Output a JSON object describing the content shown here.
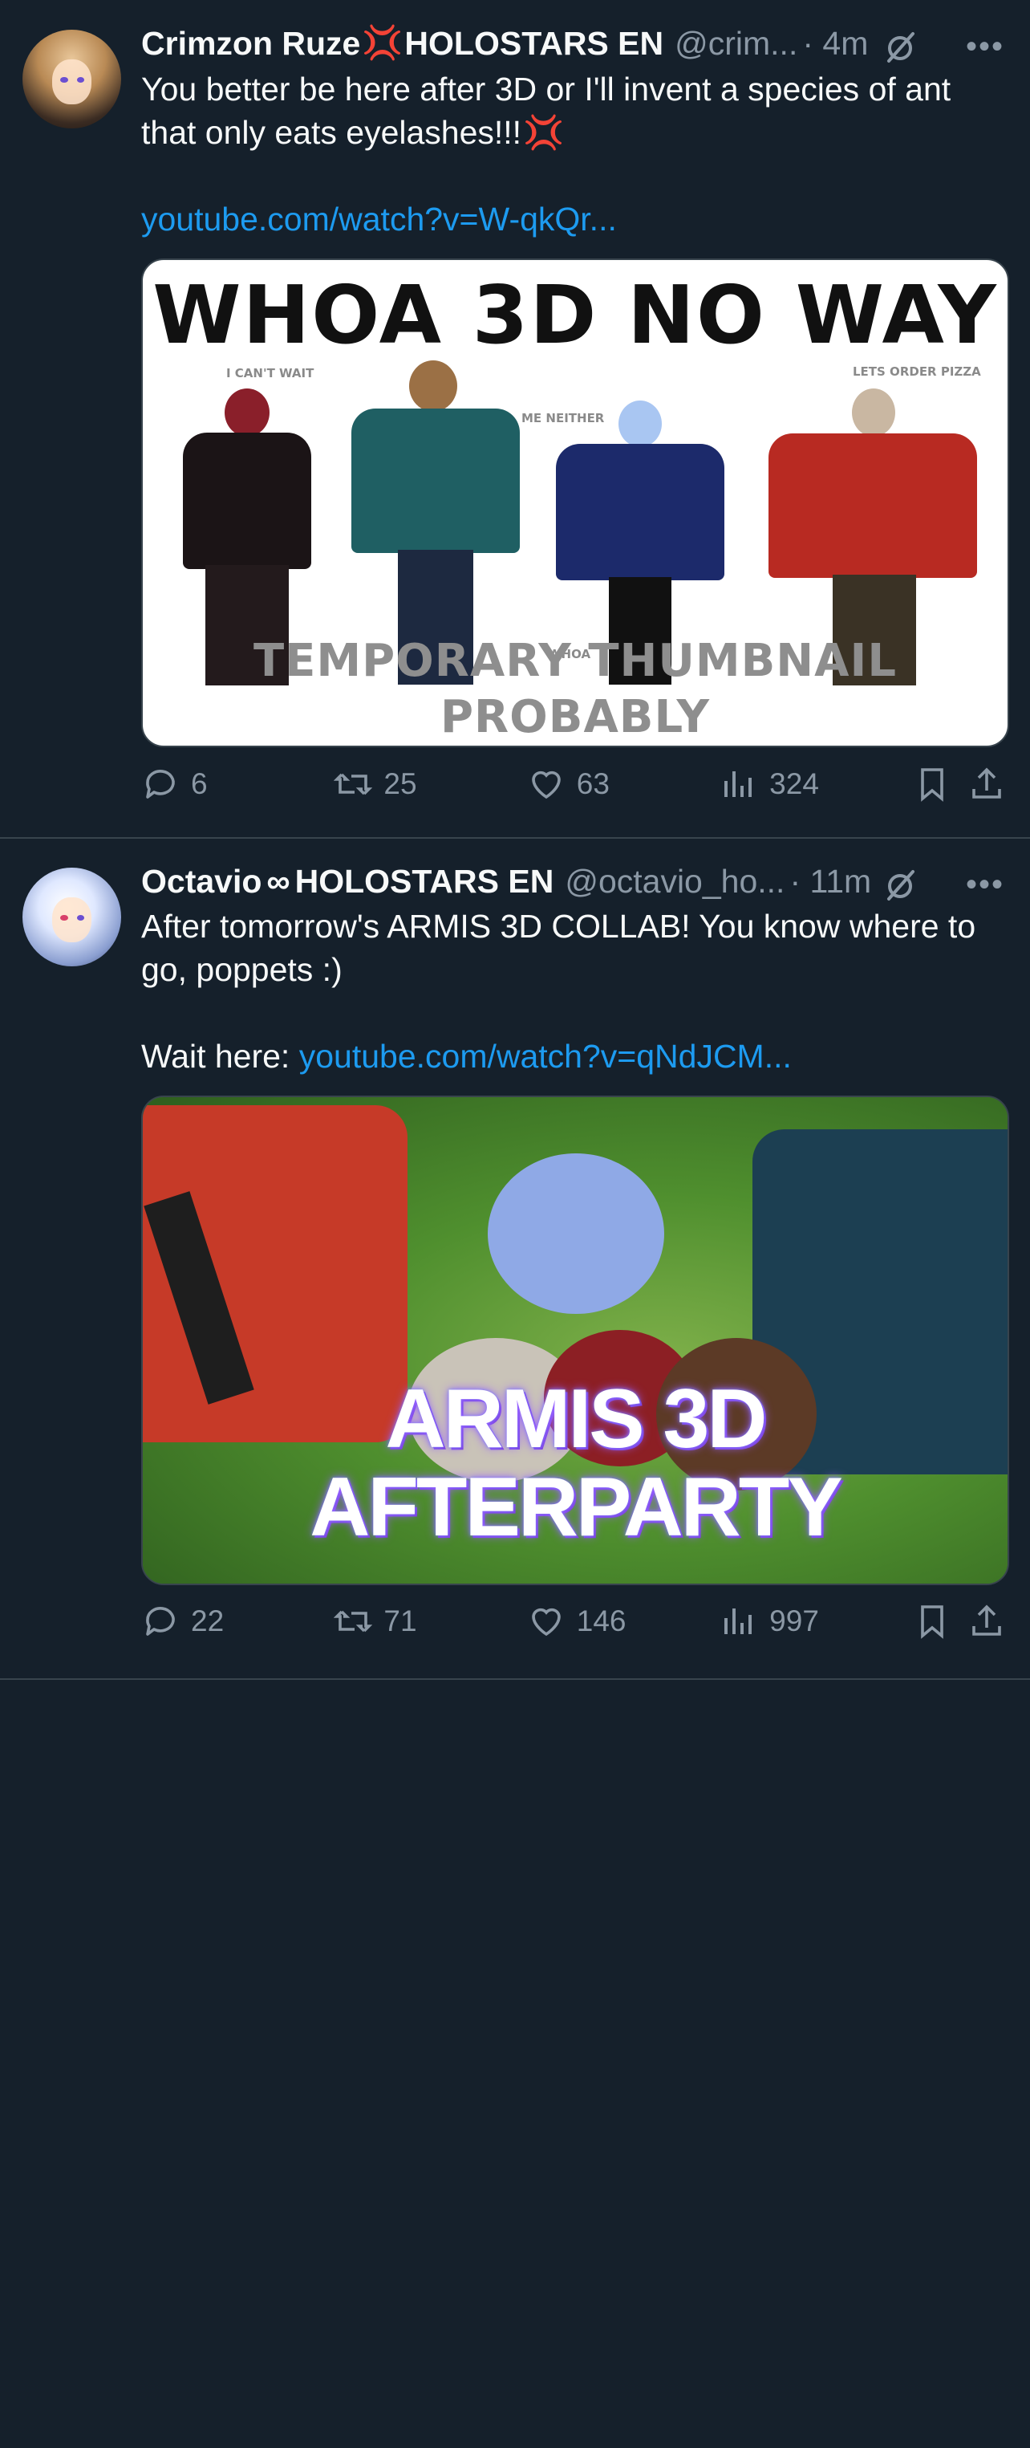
{
  "tweets": [
    {
      "author": {
        "name": "Crimzon Ruze",
        "emoji_mid": "💢",
        "name_suffix": "HOLOSTARS EN",
        "handle": "@crim...",
        "time": "· 4m"
      },
      "text": "You better be here after 3D or I'll invent a species of ant that only eats eyelashes!!!",
      "text_emoji": "💢",
      "link": "youtube.com/watch?v=W-qkQr...",
      "media": {
        "title": "WHOA 3D NO WAY",
        "captions": [
          "I CAN'T WAIT",
          "ME NEITHER",
          "WHOA",
          "LETS ORDER PIZZA"
        ],
        "bottom": "TEMPORARY THUMBNAIL PROBABLY"
      },
      "stats": {
        "replies": "6",
        "reposts": "25",
        "likes": "63",
        "views": "324"
      }
    },
    {
      "author": {
        "name": "Octavio",
        "emoji_mid": "∞",
        "name_suffix": "HOLOSTARS EN",
        "handle": "@octavio_ho...",
        "time": "· 11m"
      },
      "text": "After tomorrow's ARMIS 3D COLLAB! You know where to go, poppets :)",
      "wait_label": "Wait here:",
      "link": "youtube.com/watch?v=qNdJCM...",
      "media": {
        "title": "ARMIS 3D AFTERPARTY"
      },
      "stats": {
        "replies": "22",
        "reposts": "71",
        "likes": "146",
        "views": "997"
      }
    }
  ],
  "colors": {
    "background": "#15202b",
    "text": "#f7f9f9",
    "muted": "#8b98a5",
    "link": "#1d9bf0",
    "divider": "#38444d"
  },
  "icons": [
    "reply-icon",
    "repost-icon",
    "like-icon",
    "views-icon",
    "bookmark-icon",
    "share-icon",
    "grok-icon",
    "more-icon"
  ]
}
